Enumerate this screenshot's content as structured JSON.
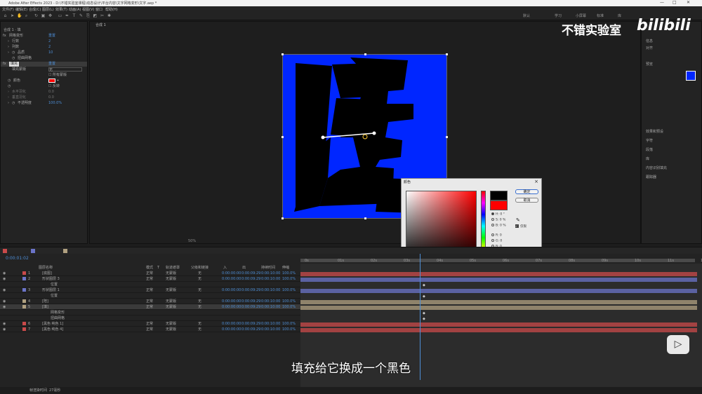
{
  "window": {
    "title": "Adobe After Effects 2023 - D:\\不错实验室课程\\动态设计\\平台内容\\文字网格变形\\文字.aep *",
    "controls": [
      "—",
      "□",
      "✕"
    ]
  },
  "menu": [
    "文件(F)",
    "编辑(E)",
    "合成(C)",
    "图层(L)",
    "效果(T)",
    "动画(A)",
    "视图(V)",
    "窗口",
    "帮助(H)"
  ],
  "workspaces": [
    "默认",
    "学习",
    "小屏幕",
    "标准",
    "库"
  ],
  "effect_controls": {
    "header": "合成 1 · 填",
    "effect_mesh": "网格变形",
    "reset": "重置",
    "rows_label": "行数",
    "rows_value": "2",
    "cols_label": "列数",
    "cols_value": "2",
    "quality_label": "品质",
    "quality_value": "10",
    "grid_label": "扭曲网格",
    "effect_fill": "填充",
    "fill_reset": "重置",
    "mask_label": "填充蒙版",
    "mask_value": "无",
    "all_masks": "所有蒙版",
    "color_label": "颜色",
    "invert": "反转",
    "h_feather": "水平羽化",
    "h_feather_value": "0.0",
    "v_feather": "垂直羽化",
    "v_feather_value": "0.0",
    "opacity_label": "不透明度",
    "opacity_value": "100.0%"
  },
  "viewer": {
    "tab": "合成 1",
    "zoom": "50%",
    "glyph_text": "陪"
  },
  "right_panel": {
    "items": [
      "信息",
      "对齐",
      "预览",
      "效果和预设",
      "字符",
      "段落",
      "库",
      "内容识别填充",
      "跟踪器"
    ],
    "color_hex": "#0026ff"
  },
  "color_dialog": {
    "title": "颜色",
    "ok": "确定",
    "cancel": "取消",
    "hue_label": "H: 0 °",
    "sat_label": "S: 0 %",
    "bri_label": "B: 0 %",
    "r_label": "R: 0",
    "g_label": "G: 0",
    "b_label": "B: 0",
    "only_web": "仅限",
    "hex_value": "000000",
    "new_color": "#000000",
    "old_color": "#ff0000"
  },
  "timeline": {
    "time": "0:00:01:02",
    "columns": [
      "图层名称",
      "模式",
      "T",
      "轨道遮罩",
      "父级和链接",
      "入",
      "出",
      "持续时间",
      "伸缩"
    ],
    "ruler": [
      "0s",
      "01s",
      "02s",
      "03s",
      "04s",
      "05s",
      "06s",
      "07s",
      "08s",
      "09s",
      "10s",
      "11s",
      "12s"
    ],
    "layers": [
      {
        "num": "1",
        "name": "[底图]",
        "mode": "正常",
        "track": "无蒙版",
        "parent": "无",
        "in": "0:00:00:00",
        "out": "0:00:09:29",
        "dur": "0:00:10:00",
        "stretch": "100.0%",
        "color": "#c94a4a"
      },
      {
        "num": "2",
        "name": "形状图层 3",
        "mode": "正常",
        "track": "无蒙版",
        "parent": "无",
        "in": "0:00:00:00",
        "out": "0:00:09:29",
        "dur": "0:00:10:00",
        "stretch": "100.0%",
        "color": "#6b74c9"
      },
      {
        "num": "",
        "name": "位置",
        "mode": "",
        "track": "",
        "parent": "",
        "in": "",
        "out": "",
        "dur": "",
        "stretch": "",
        "color": ""
      },
      {
        "num": "3",
        "name": "形状图层 1",
        "mode": "正常",
        "track": "无蒙版",
        "parent": "无",
        "in": "0:00:00:00",
        "out": "0:00:09:29",
        "dur": "0:00:10:00",
        "stretch": "100.0%",
        "color": "#6b74c9"
      },
      {
        "num": "",
        "name": "位置",
        "mode": "",
        "track": "",
        "parent": "",
        "in": "",
        "out": "",
        "dur": "",
        "stretch": "",
        "color": ""
      },
      {
        "num": "4",
        "name": "[陪]",
        "mode": "正常",
        "track": "无蒙版",
        "parent": "无",
        "in": "0:00:00:00",
        "out": "0:00:09:29",
        "dur": "0:00:10:00",
        "stretch": "100.0%",
        "color": "#b0a080"
      },
      {
        "num": "5",
        "name": "[填]",
        "mode": "正常",
        "track": "无蒙版",
        "parent": "无",
        "in": "0:00:00:00",
        "out": "0:00:09:29",
        "dur": "0:00:10:00",
        "stretch": "100.0%",
        "color": "#b0a080"
      },
      {
        "num": "",
        "name": "网格变形",
        "mode": "",
        "track": "",
        "parent": "",
        "in": "",
        "out": "",
        "dur": "",
        "stretch": "",
        "color": ""
      },
      {
        "num": "",
        "name": "扭曲网格",
        "mode": "",
        "track": "",
        "parent": "",
        "in": "",
        "out": "",
        "dur": "",
        "stretch": "",
        "color": ""
      },
      {
        "num": "6",
        "name": "[黑色 纯色 1]",
        "mode": "正常",
        "track": "无蒙版",
        "parent": "无",
        "in": "0:00:00:00",
        "out": "0:00:09:29",
        "dur": "0:00:10:00",
        "stretch": "100.0%",
        "color": "#c94a4a"
      },
      {
        "num": "7",
        "name": "[黑色 纯色 4]",
        "mode": "正常",
        "track": "无蒙版",
        "parent": "无",
        "in": "0:00:00:00",
        "out": "0:00:09:29",
        "dur": "0:00:10:00",
        "stretch": "100.0%",
        "color": "#c94a4a"
      }
    ],
    "render_time_label": "帧渲染时间",
    "render_time": "27毫秒"
  },
  "overlay": {
    "subtitle": "填充给它换成一个黑色",
    "watermark_cn": "不错实验室",
    "watermark_logo": "bilibili"
  }
}
